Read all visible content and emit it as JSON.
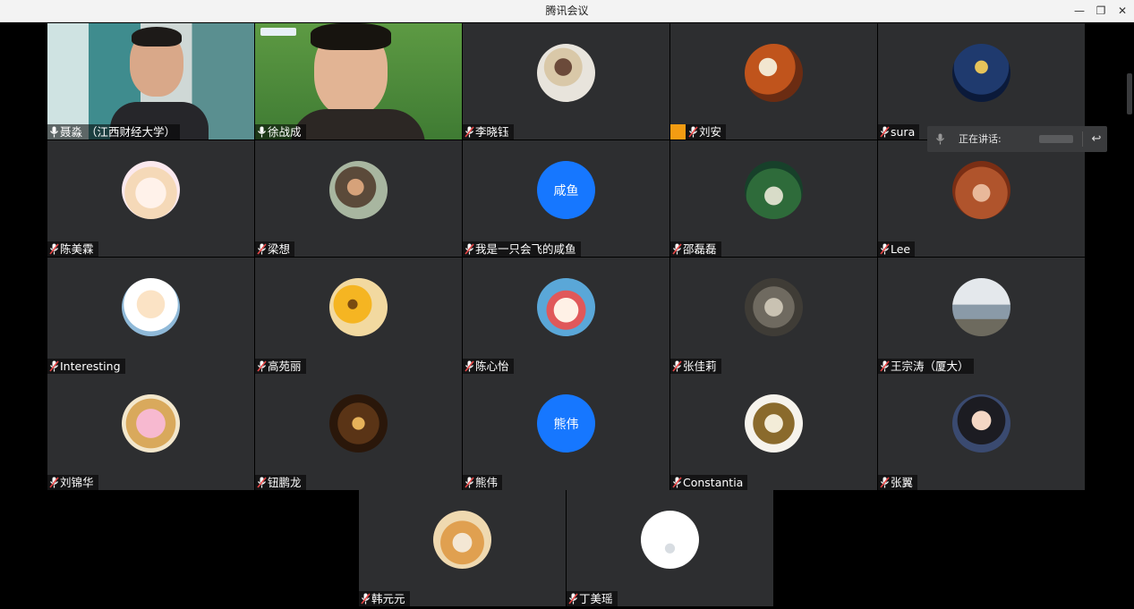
{
  "app": {
    "title": "腾讯会议"
  },
  "window_controls": {
    "minimize": "—",
    "restore": "❐",
    "close": "✕"
  },
  "speaking": {
    "label": "正在讲话:"
  },
  "participants": [
    {
      "name": "聂淼 （江西财经大学）",
      "kind": "video-host",
      "mic": "on"
    },
    {
      "name": "徐战成",
      "kind": "video-guest",
      "mic": "on"
    },
    {
      "name": "李晓钰",
      "kind": "photographer",
      "mic": "off"
    },
    {
      "name": "刘安",
      "kind": "autumn",
      "mic": "off",
      "host_badge": true
    },
    {
      "name": "sura",
      "kind": "night",
      "mic": "off"
    },
    {
      "name": "陈美霖",
      "kind": "anime",
      "mic": "off"
    },
    {
      "name": "梁想",
      "kind": "photo-girl",
      "mic": "off"
    },
    {
      "name": "我是一只会飞的咸鱼",
      "kind": "text",
      "avatar_text": "咸鱼",
      "mic": "off"
    },
    {
      "name": "邵磊磊",
      "kind": "peacock",
      "mic": "off"
    },
    {
      "name": "Lee",
      "kind": "bear",
      "mic": "off"
    },
    {
      "name": "Interesting",
      "kind": "charlie",
      "mic": "off"
    },
    {
      "name": "高苑丽",
      "kind": "flowers",
      "mic": "off"
    },
    {
      "name": "陈心怡",
      "kind": "cartoon-girl",
      "mic": "off"
    },
    {
      "name": "张佳莉",
      "kind": "kitten",
      "mic": "off"
    },
    {
      "name": "王宗涛（厦大）",
      "kind": "city",
      "mic": "off"
    },
    {
      "name": "刘锦华",
      "kind": "pig",
      "mic": "off"
    },
    {
      "name": "钮鹏龙",
      "kind": "dinner",
      "mic": "off"
    },
    {
      "name": "熊伟",
      "kind": "text",
      "avatar_text": "熊伟",
      "mic": "off"
    },
    {
      "name": "Constantia",
      "kind": "tiger",
      "mic": "off"
    },
    {
      "name": "张翼",
      "kind": "boy",
      "mic": "off"
    },
    {
      "name": "韩元元",
      "kind": "shiba",
      "mic": "off"
    },
    {
      "name": "丁美瑶",
      "kind": "white",
      "mic": "off"
    }
  ],
  "colors": {
    "tile_bg": "#2d2e30",
    "text_avatar": "#1677ff",
    "host_badge": "#f39c12",
    "mic_off": "#e64545"
  }
}
